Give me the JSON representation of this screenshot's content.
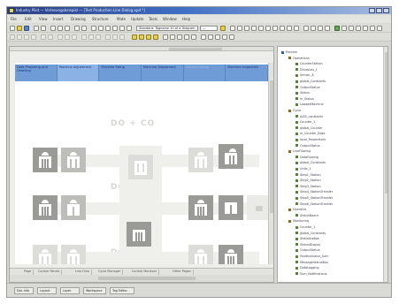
{
  "window": {
    "title": "Industry Pilot — Vorlesungsbeispiel — [Test Production Line Dialog.xpd *]"
  },
  "menu": [
    "File",
    "Edit",
    "View",
    "Insert",
    "Drawing",
    "Structure",
    "Mate",
    "Update",
    "Tools",
    "Window",
    "Help"
  ],
  "toolbar": {
    "style_combo": "Standard: Tagname 10 of a Diagram",
    "zoom_combo": "—"
  },
  "canvas_tabs": [
    {
      "label": "Data Preparing and Ordering",
      "state": "normal"
    },
    {
      "label": "Machine Adjustment",
      "state": "active"
    },
    {
      "label": "Machine Setup",
      "state": "normal"
    },
    {
      "label": "Machine Adjustment",
      "state": "normal"
    },
    {
      "label": "Machine Setup",
      "state": "dim"
    },
    {
      "label": "Machine Inspection",
      "state": "normal"
    }
  ],
  "canvas_watermarks": [
    "DO + CO",
    "DO + CO",
    "DO + CO"
  ],
  "bottom_tabs": [
    "Page",
    "Control Panels",
    "Line-Flow",
    "Cycle Manager",
    "Control Monitors",
    "Other Pages"
  ],
  "status_items": [
    "Doc Info",
    "Layout",
    "Layer",
    "Workspace",
    "Tag Editor"
  ],
  "tree": [
    {
      "level": 0,
      "label": "Process"
    },
    {
      "level": 1,
      "label": "Operations"
    },
    {
      "level": 2,
      "label": "CounterStation"
    },
    {
      "level": 2,
      "label": "DriveAxis_1"
    },
    {
      "level": 2,
      "label": "Sensor_A"
    },
    {
      "level": 2,
      "label": "global_Constants"
    },
    {
      "level": 2,
      "label": "OutputStatus"
    },
    {
      "level": 2,
      "label": "Status"
    },
    {
      "level": 2,
      "label": "m_Status"
    },
    {
      "level": 2,
      "label": "LoadedMachine"
    },
    {
      "level": 1,
      "label": "Cycle"
    },
    {
      "level": 2,
      "label": "AXIS_constants"
    },
    {
      "level": 2,
      "label": "Counter_1"
    },
    {
      "level": 2,
      "label": "global_Counter"
    },
    {
      "level": 2,
      "label": "m_Counter_Base"
    },
    {
      "level": 2,
      "label": "local_Parameters"
    },
    {
      "level": 2,
      "label": "OutputStatus"
    },
    {
      "level": 1,
      "label": "LineFlowing"
    },
    {
      "level": 2,
      "label": "DataFlowing"
    },
    {
      "level": 2,
      "label": "global_Constants"
    },
    {
      "level": 2,
      "label": "Units_1"
    },
    {
      "level": 2,
      "label": "Step1_Station"
    },
    {
      "level": 2,
      "label": "Step2_Station"
    },
    {
      "level": 2,
      "label": "Step3_Station"
    },
    {
      "level": 2,
      "label": "Step4_StationTransfer"
    },
    {
      "level": 2,
      "label": "Step5_StationTransfer"
    },
    {
      "level": 2,
      "label": "Step6_StationTransfer"
    },
    {
      "level": 1,
      "label": "Operator"
    },
    {
      "level": 2,
      "label": "StatusBoard"
    },
    {
      "level": 1,
      "label": "Monitoring"
    },
    {
      "level": 2,
      "label": "Counter_1"
    },
    {
      "level": 2,
      "label": "global_Constants"
    },
    {
      "level": 2,
      "label": "StatisticsBox"
    },
    {
      "level": 2,
      "label": "StatusDisplay"
    },
    {
      "level": 2,
      "label": "OutputStatus"
    },
    {
      "level": 2,
      "label": "FaultIndicator_Sum"
    },
    {
      "level": 2,
      "label": "MessageStatusBox"
    },
    {
      "level": 2,
      "label": "DataLogging"
    },
    {
      "level": 2,
      "label": "Sum_Notifications"
    }
  ],
  "colors": {
    "tab_bar": "#6f9bd6",
    "tab_active": "#8ab2e4",
    "block_dark": "#9a9a96",
    "block_mid": "#bdbdb9",
    "title_bar": "#2a3f85"
  }
}
